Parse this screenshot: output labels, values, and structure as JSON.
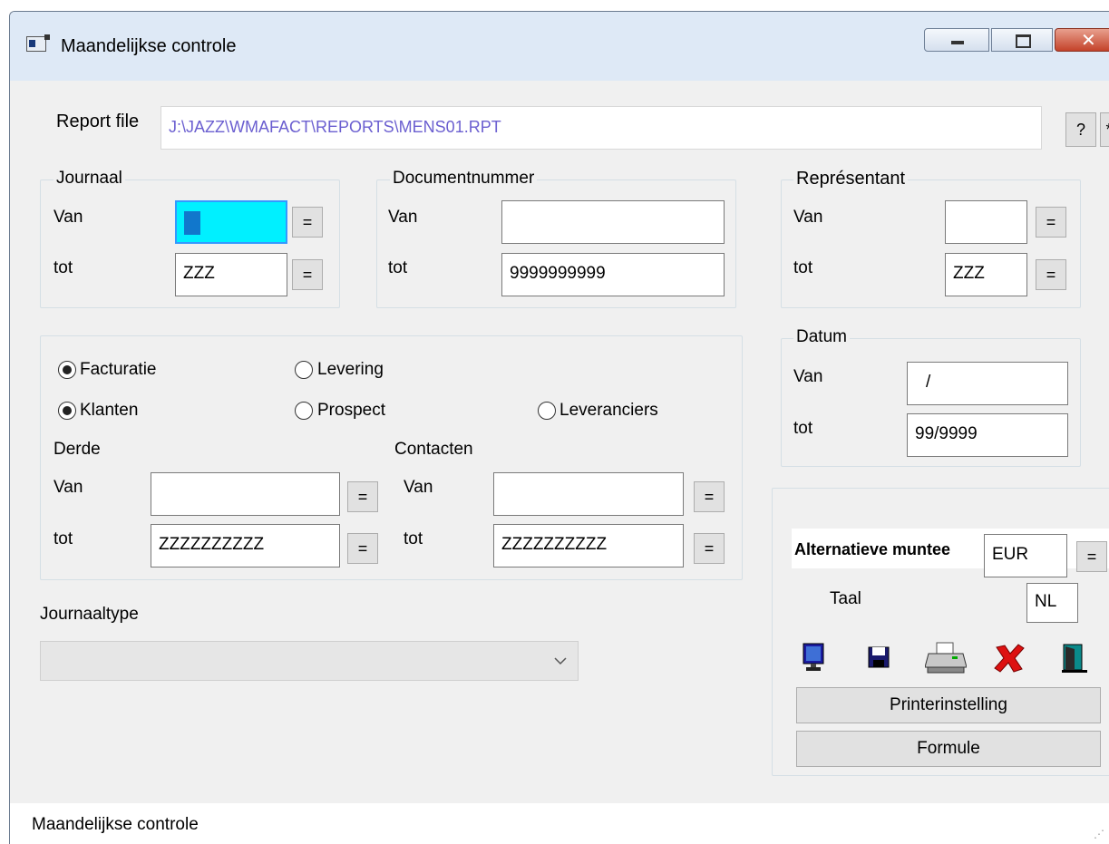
{
  "window": {
    "title": "Maandelijkse controle"
  },
  "report": {
    "label": "Report file",
    "value": "J:\\JAZZ\\WMAFACT\\REPORTS\\MENS01.RPT",
    "help_btn": "?",
    "more_btn": "*"
  },
  "journaal": {
    "legend": "Journaal",
    "van_label": "Van",
    "tot_label": "tot",
    "van_value": "",
    "tot_value": "ZZZ",
    "eq": "="
  },
  "documentnummer": {
    "legend": "Documentnummer",
    "van_label": "Van",
    "tot_label": "tot",
    "van_value": "",
    "tot_value": "9999999999"
  },
  "representant": {
    "legend": "Représentant",
    "van_label": "Van",
    "tot_label": "tot",
    "van_value": "",
    "tot_value": "ZZZ",
    "eq": "="
  },
  "datum": {
    "legend": "Datum",
    "van_label": "Van",
    "tot_label": "tot",
    "van_value": "/",
    "tot_value": "99/9999"
  },
  "options": {
    "facturatie": "Facturatie",
    "levering": "Levering",
    "klanten": "Klanten",
    "prospect": "Prospect",
    "leveranciers": "Leveranciers",
    "derde": {
      "label": "Derde",
      "van_label": "Van",
      "tot_label": "tot",
      "van_value": "",
      "tot_value": "ZZZZZZZZZZ",
      "eq": "="
    },
    "contacten": {
      "label": "Contacten",
      "van_label": "Van",
      "tot_label": "tot",
      "van_value": "",
      "tot_value": "ZZZZZZZZZZ",
      "eq": "="
    }
  },
  "journaaltype": {
    "label": "Journaaltype",
    "value": ""
  },
  "currency": {
    "label": "Alternatieve muntee",
    "value": "EUR",
    "eq": "="
  },
  "taal": {
    "label": "Taal",
    "value": "NL"
  },
  "icons": [
    "screen-preview-icon",
    "floppy-save-icon",
    "printer-icon",
    "cancel-x-icon",
    "exit-door-icon"
  ],
  "buttons": {
    "printerinstelling": "Printerinstelling",
    "formule": "Formule"
  },
  "status": {
    "text": "Maandelijkse controle"
  },
  "colors": {
    "active_field": "#00f0ff",
    "report_path": "#6b5fd0",
    "titlebar": "#dee9f6"
  }
}
